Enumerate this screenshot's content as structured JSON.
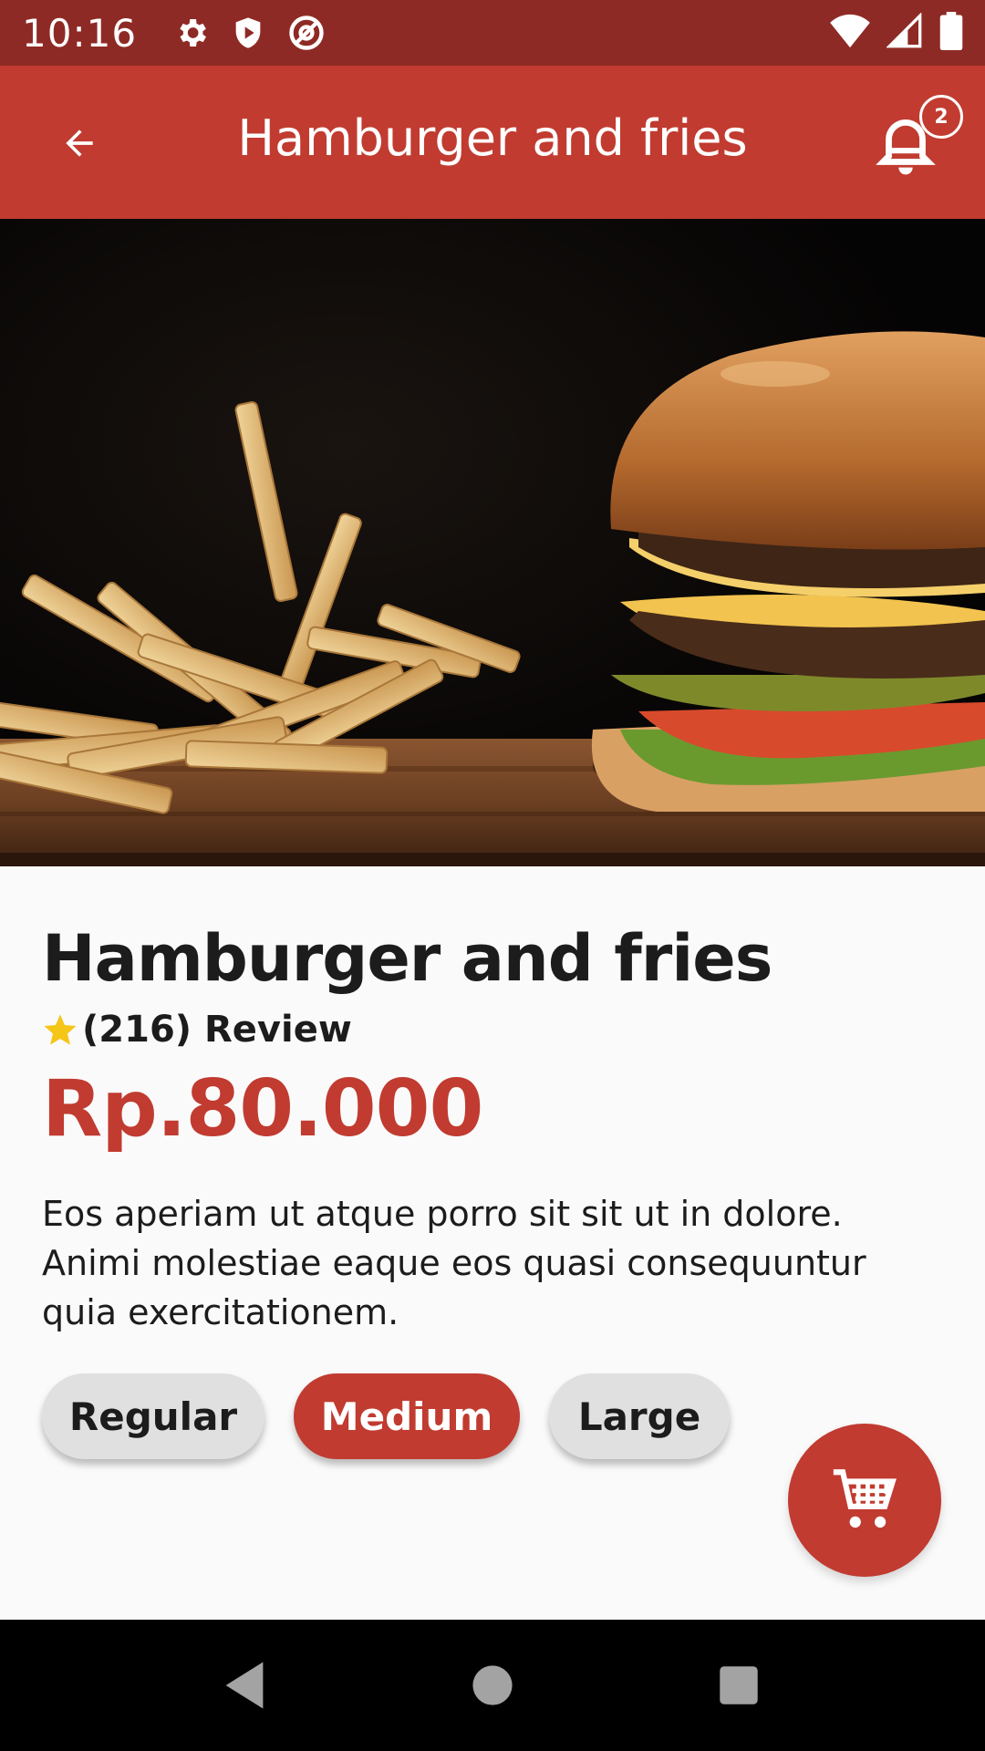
{
  "status_bar": {
    "time": "10:16",
    "left_icons": [
      "gear-icon",
      "shield-icon",
      "at-sign-icon"
    ],
    "right_icons": [
      "wifi-icon",
      "signal-icon",
      "battery-icon"
    ]
  },
  "app_bar": {
    "title": "Hamburger and fries",
    "back_icon": "arrow-left-icon",
    "notification_icon": "bell-icon",
    "notification_count": "2"
  },
  "product": {
    "image": "hamburger-and-fries-photo",
    "name": "Hamburger and fries",
    "rating_text": "(216) Review",
    "price": "Rp.80.000",
    "description": "Eos aperiam ut atque porro sit sit ut in dolore. Animi molestiae eaque eos quasi consequuntur quia exercitationem."
  },
  "sizes": {
    "options": [
      "Regular",
      "Medium",
      "Large"
    ],
    "selected": "Medium"
  },
  "cart_button": {
    "icon": "cart-icon"
  },
  "nav_bar": {
    "icons": [
      "back-triangle-icon",
      "home-circle-icon",
      "recents-square-icon"
    ]
  },
  "colors": {
    "primary": "#c13b30",
    "status_bar": "#8e2a25",
    "chip_inactive": "#e0e0e0",
    "star": "#f5c518",
    "text": "#1c1c1c"
  }
}
